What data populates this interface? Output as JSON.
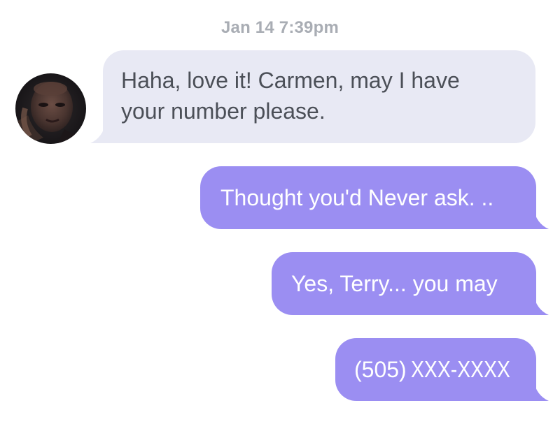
{
  "conversation": {
    "timestamp": "Jan 14 7:39pm",
    "messages": [
      {
        "direction": "incoming",
        "text": "Haha, love it! Carmen, may I have your number please.",
        "line1": "Haha, love it! Carmen, may I have",
        "line2": "your number please."
      },
      {
        "direction": "outgoing",
        "text": "Thought you'd Never ask. .."
      },
      {
        "direction": "outgoing",
        "text": "Yes, Terry... you may"
      },
      {
        "direction": "outgoing",
        "text": "(505) XXX-XXXX",
        "area": "(505)",
        "masked": "XXX-XXXX"
      }
    ]
  },
  "colors": {
    "incoming_bubble": "#e8e9f4",
    "incoming_text": "#4b4f57",
    "outgoing_bubble": "#9b8ef2",
    "outgoing_text": "#ffffff",
    "timestamp_text": "#a9adb4"
  },
  "avatar": {
    "icon": "contact-photo-avatar"
  }
}
